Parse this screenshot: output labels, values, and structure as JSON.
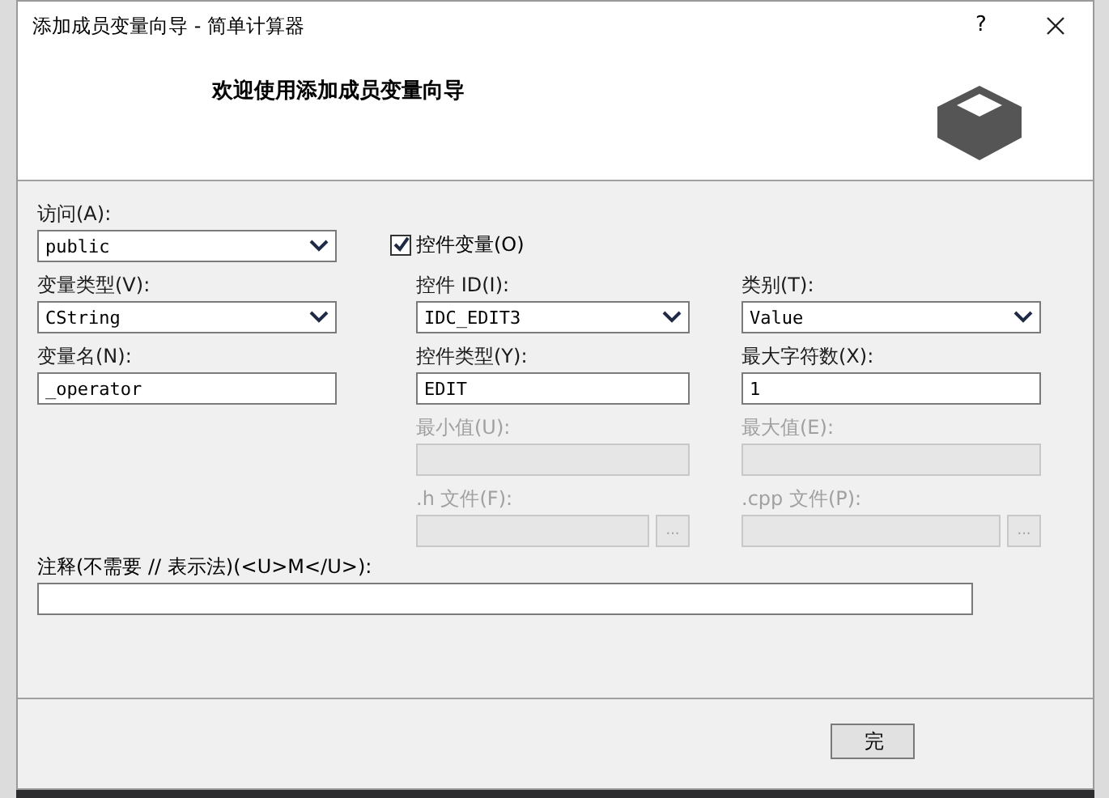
{
  "window": {
    "title": "添加成员变量向导 - 简单计算器",
    "help": "?"
  },
  "header": {
    "heading": "欢迎使用添加成员变量向导"
  },
  "left_fields": [
    {
      "label": "访问(A):",
      "value": "public",
      "kind": "combo",
      "disabled": false
    },
    {
      "label": "变量类型(V):",
      "value": "CString",
      "kind": "combo",
      "disabled": false
    },
    {
      "label": "变量名(N):",
      "value": "_operator",
      "kind": "text",
      "disabled": false
    }
  ],
  "control_variable": {
    "label": "控件变量(O)",
    "checked": true
  },
  "middle_fields": [
    {
      "label": "控件 ID(I):",
      "value": "IDC_EDIT3",
      "kind": "combo",
      "disabled": false
    },
    {
      "label": "控件类型(Y):",
      "value": "EDIT",
      "kind": "text",
      "disabled": false
    },
    {
      "label": "最小值(U):",
      "kind": "text",
      "disabled": true
    },
    {
      "label": ".h 文件(F):",
      "kind": "browse",
      "disabled": true,
      "button": "..."
    }
  ],
  "right_fields": [
    {
      "label": "类别(T):",
      "value": "Value",
      "kind": "combo",
      "disabled": false
    },
    {
      "label": "最大字符数(X):",
      "value": "1",
      "kind": "text",
      "disabled": false
    },
    {
      "label": "最大值(E):",
      "kind": "text",
      "disabled": true
    },
    {
      "label": ".cpp 文件(P):",
      "kind": "browse",
      "disabled": true,
      "button": "..."
    }
  ],
  "comment": {
    "label": "注释(不需要 // 表示法)(<U>M</U>):"
  },
  "buttons": [
    "完"
  ]
}
